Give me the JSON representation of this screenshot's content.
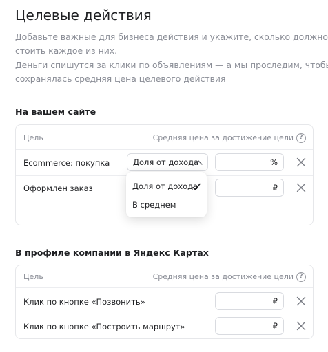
{
  "page": {
    "title": "Целевые действия",
    "description_lines": [
      "Добавьте важные для бизнеса действия и укажите, сколько должно",
      "стоить каждое из них.",
      "Деньги спишутся за клики по объявлениям — а мы проследим, чтобы",
      "сохранялась средняя цена целевого действия"
    ]
  },
  "site_section": {
    "title": "На вашем сайте",
    "header": {
      "goal": "Цель",
      "price": "Средняя цена за достижение цели",
      "help": "?"
    },
    "rows": [
      {
        "goal": "Ecommerce: покупка",
        "select_value": "Доля от дохода",
        "unit": "%",
        "select_open": true
      },
      {
        "goal": "Оформлен заказ",
        "unit": "₽"
      }
    ],
    "dropdown": {
      "options": [
        "Доля от дохода",
        "В среднем"
      ],
      "selected_index": 0
    }
  },
  "maps_section": {
    "title": "В профиле компании в Яндекс Картах",
    "header": {
      "goal": "Цель",
      "price": "Средняя цена за достижение цели",
      "help": "?"
    },
    "rows": [
      {
        "goal": "Клик по кнопке «Позвонить»",
        "unit": "₽"
      },
      {
        "goal": "Клик по кнопке «Построить маршрут»",
        "unit": "₽"
      }
    ]
  },
  "colors": {
    "text": "#1f2023",
    "muted": "#8a8d96",
    "border": "#d9dbe0"
  }
}
